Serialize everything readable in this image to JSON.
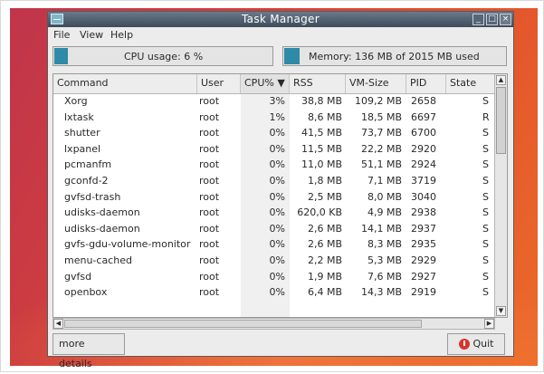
{
  "window": {
    "title": "Task Manager"
  },
  "menu": {
    "items": [
      "File",
      "View",
      "Help"
    ]
  },
  "meters": {
    "cpu": {
      "label": "CPU usage: 6 %",
      "fraction": 0.06
    },
    "memory": {
      "label": "Memory: 136 MB of 2015 MB used",
      "fraction": 0.07
    }
  },
  "table": {
    "columns": [
      "Command",
      "User",
      "CPU% ▼",
      "RSS",
      "VM-Size",
      "PID",
      "State"
    ],
    "rows": [
      [
        "Xorg",
        "root",
        "3%",
        "38,8 MB",
        "109,2 MB",
        "2658",
        "S"
      ],
      [
        "lxtask",
        "root",
        "1%",
        "8,6 MB",
        "18,5 MB",
        "6697",
        "R"
      ],
      [
        "shutter",
        "root",
        "0%",
        "41,5 MB",
        "73,7 MB",
        "6700",
        "S"
      ],
      [
        "lxpanel",
        "root",
        "0%",
        "11,5 MB",
        "22,2 MB",
        "2920",
        "S"
      ],
      [
        "pcmanfm",
        "root",
        "0%",
        "11,0 MB",
        "51,1 MB",
        "2924",
        "S"
      ],
      [
        "gconfd-2",
        "root",
        "0%",
        "1,8 MB",
        "7,1 MB",
        "3719",
        "S"
      ],
      [
        "gvfsd-trash",
        "root",
        "0%",
        "2,5 MB",
        "8,0 MB",
        "3040",
        "S"
      ],
      [
        "udisks-daemon",
        "root",
        "0%",
        "620,0 KB",
        "4,9 MB",
        "2938",
        "S"
      ],
      [
        "udisks-daemon",
        "root",
        "0%",
        "2,6 MB",
        "14,1 MB",
        "2937",
        "S"
      ],
      [
        "gvfs-gdu-volume-monitor",
        "root",
        "0%",
        "2,6 MB",
        "8,3 MB",
        "2935",
        "S"
      ],
      [
        "menu-cached",
        "root",
        "0%",
        "2,2 MB",
        "5,3 MB",
        "2929",
        "S"
      ],
      [
        "gvfsd",
        "root",
        "0%",
        "1,9 MB",
        "7,6 MB",
        "2927",
        "S"
      ],
      [
        "openbox",
        "root",
        "0%",
        "6,4 MB",
        "14,3 MB",
        "2919",
        "S"
      ]
    ]
  },
  "buttons": {
    "more_details": "more details",
    "quit": "Quit"
  }
}
